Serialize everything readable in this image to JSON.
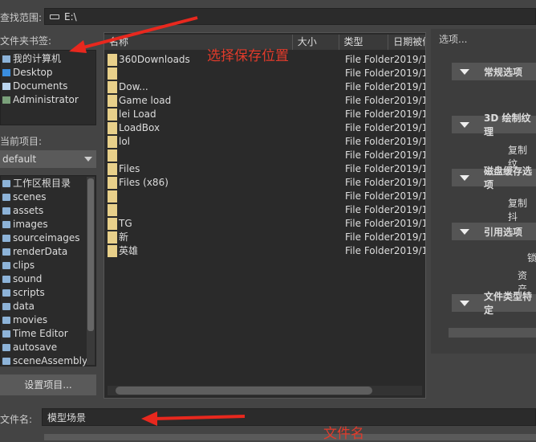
{
  "look_in": {
    "label": "查找范围:",
    "value": "E:\\"
  },
  "bookmarks": {
    "label": "文件夹书签:",
    "items": [
      {
        "label": "我的计算机",
        "icon": "computer-icon"
      },
      {
        "label": "Desktop",
        "icon": "desktop-icon"
      },
      {
        "label": "Documents",
        "icon": "documents-icon"
      },
      {
        "label": "Administrator",
        "icon": "user-icon"
      }
    ]
  },
  "project": {
    "label": "当前项目:",
    "selected": "default",
    "folders": [
      "工作区根目录",
      "scenes",
      "assets",
      "images",
      "sourceimages",
      "renderData",
      "clips",
      "sound",
      "scripts",
      "data",
      "movies",
      "Time Editor",
      "autosave",
      "sceneAssembly"
    ],
    "set_button": "设置项目..."
  },
  "files": {
    "columns": [
      "名称",
      "大小",
      "类型",
      "日期被修改"
    ],
    "rows": [
      {
        "name": "360Downloads",
        "type": "File Folder",
        "date": "2019/1..."
      },
      {
        "name": "",
        "type": "File Folder",
        "date": "2019/1..."
      },
      {
        "name": "Dow...",
        "type": "File Folder",
        "date": "2019/1..."
      },
      {
        "name": "Game  load",
        "type": "File Folder",
        "date": "2019/1..."
      },
      {
        "name": "lei  Load",
        "type": "File Folder",
        "date": "2019/1..."
      },
      {
        "name": "LoadBox",
        "type": "File Folder",
        "date": "2019/1..."
      },
      {
        "name": "lol",
        "type": "File Folder",
        "date": "2019/1..."
      },
      {
        "name": "",
        "type": "File Folder",
        "date": "2019/1..."
      },
      {
        "name": "Files",
        "type": "File Folder",
        "date": "2019/1..."
      },
      {
        "name": "Files (x86)",
        "type": "File Folder",
        "date": "2019/1..."
      },
      {
        "name": "",
        "type": "File Folder",
        "date": "2019/1..."
      },
      {
        "name": "",
        "type": "File Folder",
        "date": "2019/1..."
      },
      {
        "name": "TG",
        "type": "File Folder",
        "date": "2019/1..."
      },
      {
        "name": "新",
        "type": "File Folder",
        "date": "2019/1..."
      },
      {
        "name": "英雄",
        "type": "File Folder",
        "date": "2019/1..."
      }
    ]
  },
  "options": {
    "label": "选项...",
    "sections": [
      "常规选项",
      "3D 绘制纹理",
      "磁盘缓存选项",
      "引用选项",
      "文件类型特定"
    ],
    "sub": [
      "复制纹",
      "复制抖",
      "锁",
      "资产"
    ]
  },
  "filename": {
    "label": "文件名:",
    "value": "模型场景"
  },
  "annotations": {
    "location": "选择保存位置",
    "filename": "文件名"
  }
}
